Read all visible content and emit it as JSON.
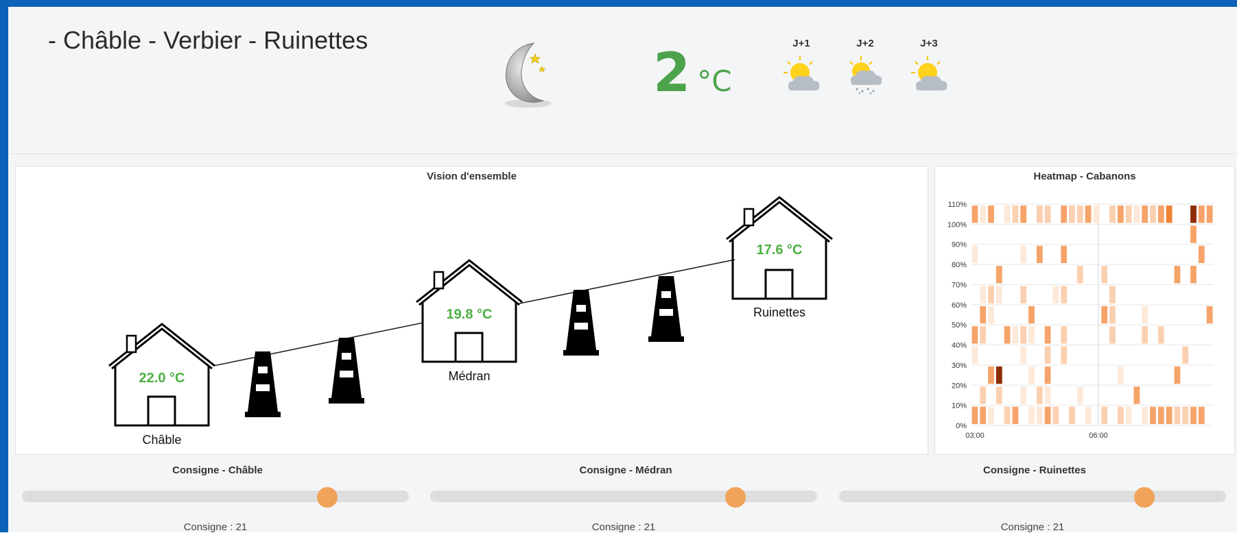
{
  "header": {
    "title": "- Châble - Verbier - Ruinettes",
    "current_temp": "2",
    "temp_unit": "°C",
    "current_icon": "moon-stars-icon",
    "forecast": [
      {
        "label": "J+1",
        "icon": "sun-cloud-icon"
      },
      {
        "label": "J+2",
        "icon": "sun-cloud-snow-icon"
      },
      {
        "label": "J+3",
        "icon": "sun-cloud-icon"
      }
    ]
  },
  "overview": {
    "title": "Vision d'ensemble",
    "stations": [
      {
        "name": "Châble",
        "temp": "22.0 °C"
      },
      {
        "name": "Médran",
        "temp": "19.8 °C"
      },
      {
        "name": "Ruinettes",
        "temp": "17.6 °C"
      }
    ]
  },
  "heatmap": {
    "title": "Heatmap - Cabanons",
    "y_labels": [
      "110%",
      "100%",
      "90%",
      "80%",
      "70%",
      "60%",
      "50%",
      "40%",
      "30%",
      "20%",
      "10%",
      "0%"
    ],
    "x_labels": [
      "03:00",
      "06:00"
    ]
  },
  "sliders": [
    {
      "title": "Consigne - Châble",
      "value_text": "Consigne : 21",
      "value": 21
    },
    {
      "title": "Consigne - Médran",
      "value_text": "Consigne : 21",
      "value": 21
    },
    {
      "title": "Consigne - Ruinettes",
      "value_text": "Consigne : 21",
      "value": 21
    }
  ],
  "colors": {
    "accent_green": "#4ca34c",
    "slider_thumb": "#f0a35a",
    "frame_blue": "#0b62b8"
  }
}
